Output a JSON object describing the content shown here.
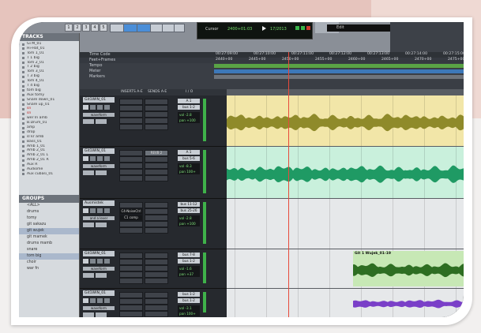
{
  "transport": {
    "nav_numbers": [
      "1",
      "2",
      "3",
      "4",
      "5"
    ],
    "counter_label": "Cursor",
    "counter_main": "2400+01:03",
    "counter_secondary": "17/2013",
    "top_right_text": "Edit"
  },
  "tracks_panel": {
    "title": "TRACKS",
    "items": [
      {
        "label": "Gi M_01",
        "red": false
      },
      {
        "label": "Hi-Hat_01",
        "red": false
      },
      {
        "label": "Tom 1_01",
        "red": false
      },
      {
        "label": "T 1 big",
        "red": false
      },
      {
        "label": "Tom 2_01",
        "red": false
      },
      {
        "label": "T 2 big",
        "red": false
      },
      {
        "label": "Tom 3_01",
        "red": false
      },
      {
        "label": "T 3 big",
        "red": false
      },
      {
        "label": "Tom 4_01",
        "red": false
      },
      {
        "label": "T 4 big",
        "red": false
      },
      {
        "label": "tom big",
        "red": false
      },
      {
        "label": "Aux tomy",
        "red": false
      },
      {
        "label": "Snare down_01",
        "red": false
      },
      {
        "label": "Snare up_01",
        "red": false
      },
      {
        "label": "sn",
        "red": true
      },
      {
        "label": "sn",
        "red": true
      },
      {
        "label": "wer In amb",
        "red": false
      },
      {
        "label": "B.Drum_01",
        "red": false
      },
      {
        "label": "amp",
        "red": false
      },
      {
        "label": "drop",
        "red": false
      },
      {
        "label": "sl kr amb",
        "red": false
      },
      {
        "label": "Bass_01",
        "red": false
      },
      {
        "label": "Amb 1_01",
        "red": false
      },
      {
        "label": "Amb 2_01",
        "red": false
      },
      {
        "label": "Amb 2_01 L",
        "red": false
      },
      {
        "label": "Amb 2_01 R",
        "red": false
      },
      {
        "label": "Aux R",
        "red": false
      },
      {
        "label": "Audiome",
        "red": false
      },
      {
        "label": "Aux cubasi_01",
        "red": false
      }
    ]
  },
  "groups_panel": {
    "title": "GROUPS",
    "items": [
      {
        "label": "<ALL>",
        "sel": false
      },
      {
        "label": "drums",
        "sel": false
      },
      {
        "label": "tomy",
        "sel": false
      },
      {
        "label": "git sakazu",
        "sel": false
      },
      {
        "label": "git wujek",
        "sel": true
      },
      {
        "label": "git mamek",
        "sel": false
      },
      {
        "label": "drums mamb",
        "sel": false
      },
      {
        "label": "snare",
        "sel": false
      },
      {
        "label": "tom big",
        "sel": true
      },
      {
        "label": "choir",
        "sel": false
      },
      {
        "label": "war fn",
        "sel": false
      }
    ]
  },
  "rulers": {
    "rows": [
      "Time Code",
      "Feet+Frames",
      "Tempo",
      "Meter",
      "Markers"
    ],
    "timecode_ticks": [
      "00:27:09:00",
      "00:27:10:00",
      "00:27:11:00",
      "00:27:12:00",
      "00:27:13:00",
      "00:27:14:00",
      "00:27:15:00"
    ],
    "feet_ticks": [
      "2440+00",
      "2445+00",
      "2450+00",
      "2455+00",
      "2460+00",
      "2465+00",
      "2470+00",
      "2475+00"
    ]
  },
  "mix_header": {
    "inserts": "INSERTS A-E",
    "sends": "SENDS A-E",
    "io": "I / O"
  },
  "strips": [
    {
      "name": "Git1WIN_01",
      "wave": "waveform",
      "send": "",
      "input": "A 1",
      "output": "bus 1-2",
      "vol": "-2.8",
      "pan": "+100"
    },
    {
      "name": "Git1WIN_01",
      "wave": "waveform",
      "send": "REVB 2",
      "input": "A 1",
      "output": "bus 5-6",
      "vol": "-8.3",
      "pan": "100+"
    },
    {
      "name": "Ausmistek",
      "wave": "and a lever",
      "send": "",
      "input": "bus 11-12",
      "output": "bus 25-26",
      "vol": "-2.8",
      "pan": "+100",
      "plugin1": "C4-NoiseCtrl",
      "plugin2": "C1 comp"
    },
    {
      "name": "Git1WIN_01",
      "wave": "waveform",
      "send": "",
      "input": "bus 7-8",
      "output": "bus 1-2",
      "vol": "-1.6",
      "pan": "+37"
    },
    {
      "name": "Git1WIN_01",
      "wave": "waveform",
      "send": "",
      "input": "bus 1-2",
      "output": "bus 1-2",
      "vol": "-3.1",
      "pan": "100+"
    }
  ],
  "clip_label": "Git 1 Wujek_01-19",
  "colors": {
    "lane1": "#f2e6a8",
    "wave1": "#8f8a2a",
    "lane2": "#c9f0dc",
    "wave2": "#1f9a64",
    "lane4": "#c7e8b5",
    "wave4": "#2e6e22",
    "wave5": "#7a3fc8"
  }
}
